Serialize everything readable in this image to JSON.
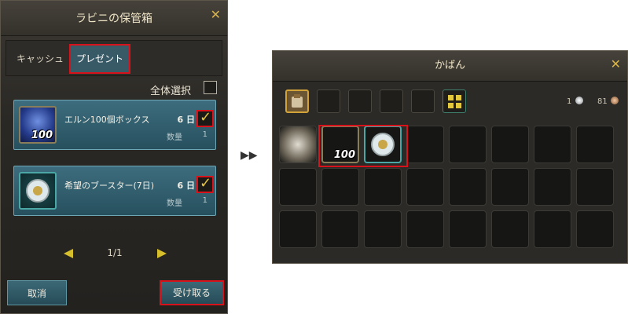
{
  "storage": {
    "title": "ラビニの保管箱",
    "tabs": [
      {
        "label": "キャッシュ"
      },
      {
        "label": "プレゼント"
      }
    ],
    "select_all_label": "全体選択",
    "items": [
      {
        "name": "エルン100個ボックス",
        "days": "6 日",
        "count_label": "数量",
        "count": "1",
        "badge": "100",
        "icon": "ern-box-icon"
      },
      {
        "name": "希望のブースター(7日)",
        "days": "6 日",
        "count_label": "数量",
        "count": "1",
        "icon": "hope-booster-icon"
      }
    ],
    "pagination": "1/1",
    "buttons": {
      "cancel": "取消",
      "receive": "受け取る"
    }
  },
  "divider": "▶▶",
  "bag": {
    "title": "かばん",
    "silver_count": "1",
    "bronze_count": "81",
    "slots": [
      {
        "item": "scroll-item-icon"
      },
      {
        "item": "ern-box-icon",
        "badge": "100"
      },
      {
        "item": "hope-booster-icon"
      }
    ]
  },
  "colors": {
    "highlight_red": "#d8121b",
    "tab_active": "#385a66",
    "gold": "#d7bf2c"
  }
}
